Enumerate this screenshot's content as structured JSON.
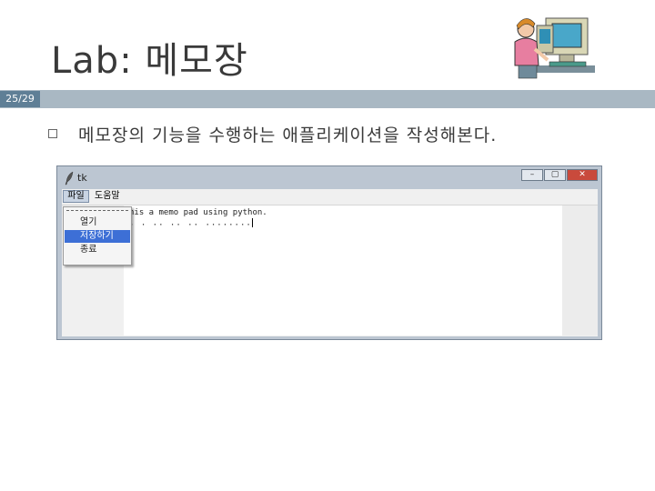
{
  "slide": {
    "title": "Lab: 메모장",
    "page": "25/29",
    "bullet": "메모장의 기능을 수행하는 애플리케이션을 작성해본다."
  },
  "window": {
    "title": "tk",
    "buttons": {
      "minimize": "–",
      "maximize": "▢",
      "close": "✕"
    },
    "menubar": {
      "file": "파일",
      "help": "도움말"
    },
    "file_menu": {
      "items": [
        "열기",
        "저장하기",
        "종료"
      ],
      "selected": "저장하기"
    },
    "text": {
      "line1": "his a memo pad using python.",
      "line2": ". . .. .. .. ........"
    }
  },
  "colors": {
    "accent_bar": "#a9b8c3",
    "page_badge": "#5f7f96",
    "menu_selection": "#3d6fd6"
  },
  "icons": {
    "clipart": "person-at-computer-icon",
    "window_icon": "tk-feather-icon"
  }
}
